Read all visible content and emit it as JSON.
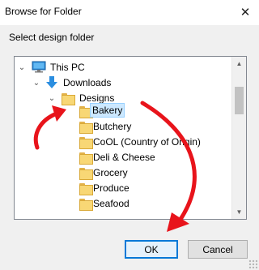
{
  "window": {
    "title": "Browse for Folder",
    "close_glyph": "✕"
  },
  "instruction": "Select design folder",
  "tree": {
    "items": [
      {
        "label": "This PC",
        "icon": "this-pc-icon"
      },
      {
        "label": "Downloads",
        "icon": "downloads-icon"
      },
      {
        "label": "Designs",
        "icon": "folder-icon"
      },
      {
        "label": "Bakery",
        "icon": "folder-icon",
        "selected": true
      },
      {
        "label": "Butchery",
        "icon": "folder-icon"
      },
      {
        "label": "CoOL (Country of Origin)",
        "icon": "folder-icon"
      },
      {
        "label": "Deli & Cheese",
        "icon": "folder-icon"
      },
      {
        "label": "Grocery",
        "icon": "folder-icon"
      },
      {
        "label": "Produce",
        "icon": "folder-icon"
      },
      {
        "label": "Seafood",
        "icon": "folder-icon"
      }
    ]
  },
  "buttons": {
    "ok": "OK",
    "cancel": "Cancel"
  },
  "colors": {
    "arrow": "#e8141b",
    "selection": "#cce8ff",
    "focus": "#0078d7"
  }
}
